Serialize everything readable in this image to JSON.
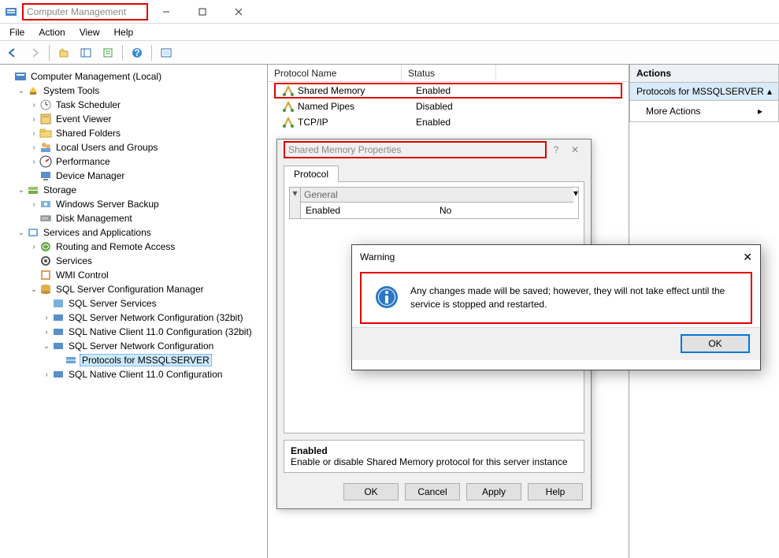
{
  "window": {
    "title": "Computer Management"
  },
  "menu": {
    "file": "File",
    "action": "Action",
    "view": "View",
    "help": "Help"
  },
  "tree": {
    "root": "Computer Management (Local)",
    "systools": "System Tools",
    "task": "Task Scheduler",
    "event": "Event Viewer",
    "shared": "Shared Folders",
    "users": "Local Users and Groups",
    "perf": "Performance",
    "devmgr": "Device Manager",
    "storage": "Storage",
    "wsb": "Windows Server Backup",
    "disk": "Disk Management",
    "services_apps": "Services and Applications",
    "rra": "Routing and Remote Access",
    "services": "Services",
    "wmi": "WMI Control",
    "sqlcfg": "SQL Server Configuration Manager",
    "sqlsvc": "SQL Server Services",
    "sqlnet32": "SQL Server Network Configuration (32bit)",
    "sqlnc32": "SQL Native Client 11.0 Configuration (32bit)",
    "sqlnet": "SQL Server Network Configuration",
    "protocols": "Protocols for MSSQLSERVER",
    "sqlnc": "SQL Native Client 11.0 Configuration"
  },
  "list": {
    "h_name": "Protocol Name",
    "h_status": "Status",
    "rows": [
      {
        "name": "Shared Memory",
        "status": "Enabled"
      },
      {
        "name": "Named Pipes",
        "status": "Disabled"
      },
      {
        "name": "TCP/IP",
        "status": "Enabled"
      }
    ]
  },
  "propdlg": {
    "title": "Shared Memory Properties",
    "tab": "Protocol",
    "gridhead": "General",
    "key": "Enabled",
    "value": "No",
    "help_title": "Enabled",
    "help_text": "Enable or disable Shared Memory protocol for this server instance",
    "ok": "OK",
    "cancel": "Cancel",
    "apply": "Apply",
    "help": "Help"
  },
  "warn": {
    "title": "Warning",
    "text": "Any changes made will be saved; however, they will not take effect until the service is stopped and restarted.",
    "ok": "OK"
  },
  "actions": {
    "header": "Actions",
    "group": "Protocols for MSSQLSERVER",
    "more": "More Actions"
  }
}
